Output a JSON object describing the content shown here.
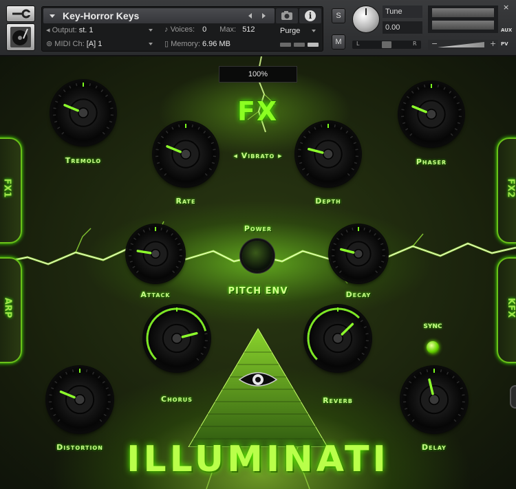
{
  "header": {
    "instrument_name": "Key-Horror Keys",
    "output_label": "Output:",
    "output_value": "st. 1",
    "voices_label": "Voices:",
    "voices_value": "0",
    "max_label": "Max:",
    "max_value": "512",
    "purge_label": "Purge",
    "midi_label": "MIDI Ch:",
    "midi_value": "[A]  1",
    "memory_label": "Memory:",
    "memory_value": "6.96 MB",
    "solo_label": "S",
    "mute_label": "M",
    "tune_label": "Tune",
    "tune_value": "0.00",
    "pan_left": "L",
    "pan_right": "R",
    "aux_label": "AUX",
    "pv_label": "PV",
    "vol_minus": "−",
    "vol_plus": "+",
    "close": "×"
  },
  "panel": {
    "zoom": "100%",
    "fx_title": "FX",
    "vibrato_label": "◂ Vibrato ▸",
    "power_label": "Power",
    "pitch_env_label": "PITCH ENV",
    "sync_label": "SYNC",
    "brand": "ILLUMINATI",
    "tabs": {
      "fx1": "FX1",
      "arp": "ARP",
      "fx2": "FX2",
      "kfx": "KFX"
    }
  },
  "knobs": [
    {
      "id": "tremolo",
      "label": "Tremolo",
      "value": 0.25
    },
    {
      "id": "rate",
      "label": "Rate",
      "value": 0.25
    },
    {
      "id": "depth",
      "label": "Depth",
      "value": 0.22
    },
    {
      "id": "phaser",
      "label": "Phaser",
      "value": 0.25
    },
    {
      "id": "attack",
      "label": "Attack",
      "value": 0.2
    },
    {
      "id": "decay",
      "label": "Decay",
      "value": 0.22
    },
    {
      "id": "chorus",
      "label": "Chorus",
      "value": 0.78
    },
    {
      "id": "reverb",
      "label": "Reverb",
      "value": 0.67
    },
    {
      "id": "distortion",
      "label": "Distortion",
      "value": 0.25
    },
    {
      "id": "delay",
      "label": "Delay",
      "value": 0.45
    }
  ]
}
